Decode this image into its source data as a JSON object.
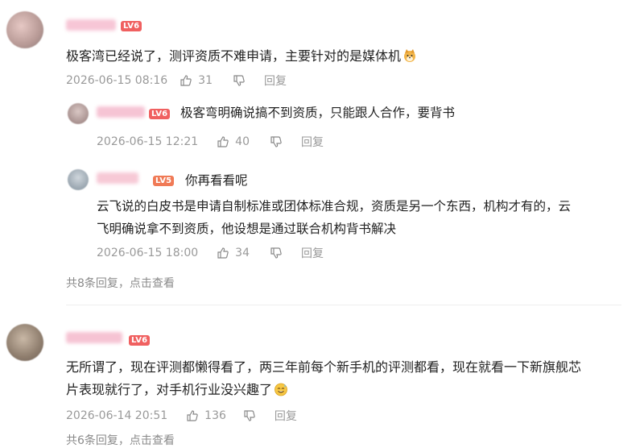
{
  "comments": [
    {
      "level": "LV6",
      "text": "极客湾已经说了，测评资质不难申请，主要针对的是媒体机",
      "emoji": "shiba-dog-emoji",
      "time": "2026-06-15 08:16",
      "likes": "31",
      "reply_label": "回复",
      "replies": [
        {
          "level": "LV6",
          "text": "极客弯明确说搞不到资质，只能跟人合作，要背书",
          "time": "2026-06-15 12:21",
          "likes": "40",
          "reply_label": "回复"
        },
        {
          "level": "LV5",
          "text": "你再看看呢",
          "text_line2": "云飞说的白皮书是申请自制标准或团体标准合规，资质是另一个东西，机构才有的，云",
          "text_line3": "飞明确说拿不到资质，他设想是通过联合机构背书解决",
          "time": "2026-06-15 18:00",
          "likes": "34",
          "reply_label": "回复"
        }
      ],
      "more_replies": "共8条回复，点击查看"
    },
    {
      "level": "LV6",
      "text_line1": "无所谓了，现在评测都懒得看了，两三年前每个新手机的评测都看，现在就看一下新旗舰芯",
      "text_line2": "片表现就行了，对手机行业没兴趣了",
      "emoji": "sweat-smile-emoji",
      "time": "2026-06-14 20:51",
      "likes": "136",
      "reply_label": "回复",
      "more_replies": "共6条回复，点击查看"
    }
  ],
  "colors": {
    "level_badge": "#f06060",
    "meta_text": "#999999",
    "divider": "#eeeeee"
  }
}
